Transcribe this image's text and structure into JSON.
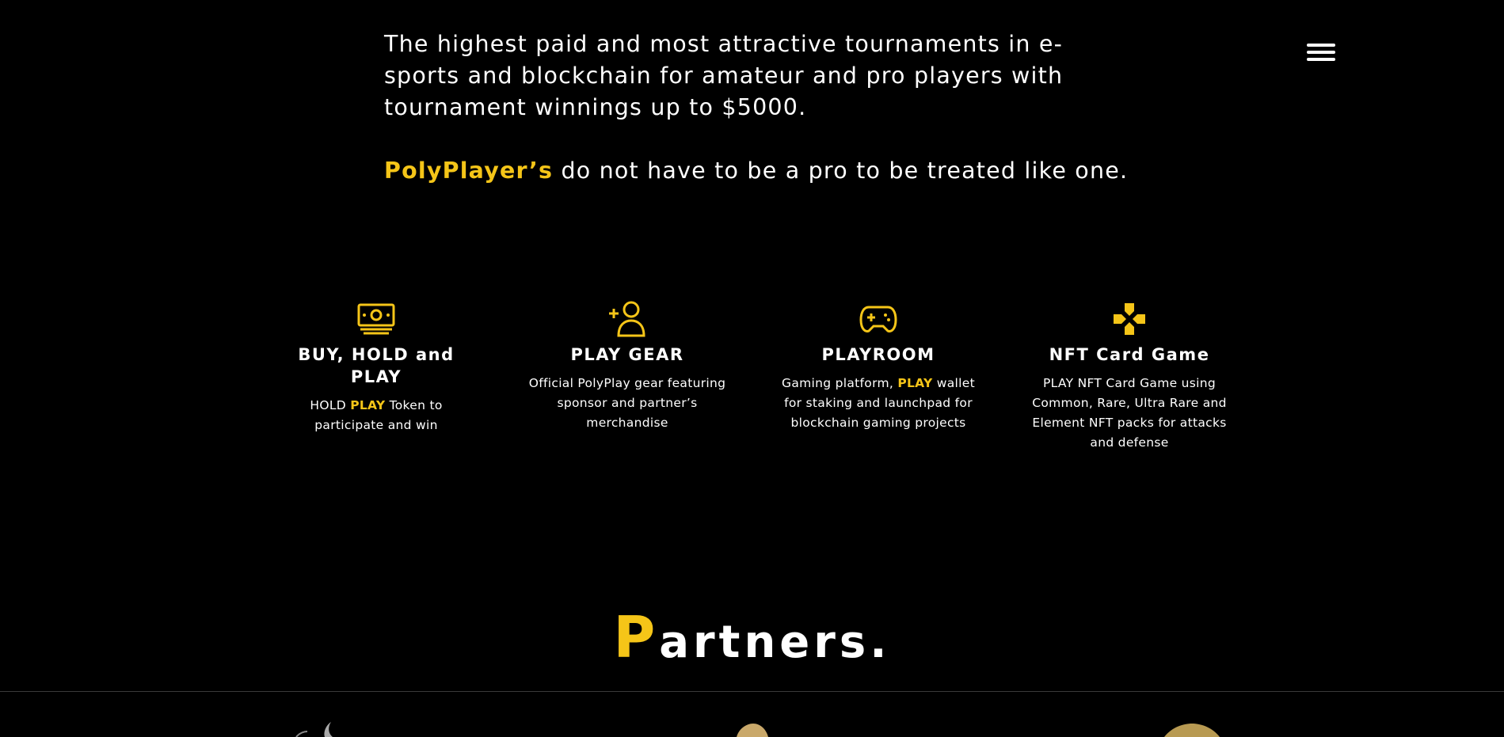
{
  "intro": {
    "paragraph": "The highest paid and most attractive tournaments in e-sports and blockchain for amateur and pro players with tournament winnings up to $5000.",
    "tagline_highlight": "PolyPlayer’s",
    "tagline_rest": " do not have to be a pro to be treated like one."
  },
  "menu": {
    "icon": "hamburger-icon"
  },
  "features": [
    {
      "icon": "cash-icon",
      "title": "BUY, HOLD and PLAY",
      "desc_pre": "HOLD ",
      "desc_hl": "PLAY",
      "desc_post": " Token to participate and win"
    },
    {
      "icon": "add-user-icon",
      "title": "PLAY GEAR",
      "desc": "Official PolyPlay gear featuring sponsor and partner’s merchandise"
    },
    {
      "icon": "gamepad-icon",
      "title": "PLAYROOM",
      "desc_pre": "Gaming platform, ",
      "desc_hl": "PLAY",
      "desc_post": " wallet for staking and launchpad for blockchain gaming projects"
    },
    {
      "icon": "dpad-icon",
      "title": "NFT Card Game",
      "desc": "PLAY NFT Card Game using Common, Rare, Ultra Rare and Element NFT packs for attacks and defense"
    }
  ],
  "partners": {
    "first_letter": "P",
    "rest": "artners."
  },
  "colors": {
    "accent": "#f5c518",
    "background": "#000000",
    "text": "#ffffff"
  }
}
